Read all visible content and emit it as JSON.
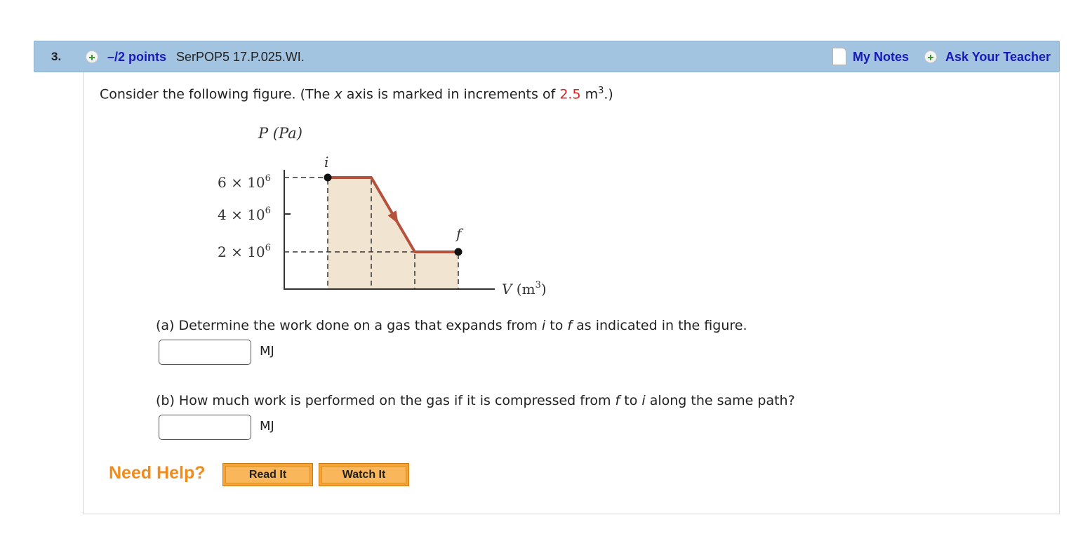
{
  "header": {
    "question_number": "3.",
    "points": "–/2 points",
    "source": "SerPOP5 17.P.025.WI.",
    "my_notes": "My Notes",
    "ask_teacher": "Ask Your Teacher",
    "icons": [
      "plus-circle-icon",
      "notes-icon",
      "plus-circle-icon"
    ]
  },
  "prompt": {
    "pre": "Consider the following figure. (The ",
    "var": "x",
    "mid": " axis is marked in increments of ",
    "value": "2.5",
    "unit": " m",
    "sup": "3",
    "post": ".)"
  },
  "figure": {
    "y_title": "P (Pa)",
    "x_title": "V (m",
    "x_title_sup": "3",
    "x_title_end": ")",
    "y_ticks": [
      {
        "base": "6 × 10",
        "exp": "6"
      },
      {
        "base": "4 × 10",
        "exp": "6"
      },
      {
        "base": "2 × 10",
        "exp": "6"
      }
    ],
    "point_i": "i",
    "point_f": "f",
    "colors": {
      "path": "#b5523b",
      "fill": "#f1e4d0",
      "point": "#111111"
    }
  },
  "chart_data": {
    "type": "line",
    "title": "",
    "xlabel": "V (m³)",
    "ylabel": "P (Pa)",
    "x_tick_increment": 2.5,
    "x": [
      2.5,
      5.0,
      7.5,
      10.0
    ],
    "series": [
      {
        "values": [
          6000000,
          6000000,
          2000000,
          2000000
        ]
      }
    ],
    "y_tick_labels": [
      "6 × 10⁶",
      "4 × 10⁶",
      "2 × 10⁶"
    ],
    "xlim": [
      0,
      12.5
    ],
    "ylim": [
      0,
      7000000
    ],
    "points": [
      {
        "label": "i",
        "x": 2.5,
        "y": 6000000
      },
      {
        "label": "f",
        "x": 10.0,
        "y": 2000000
      }
    ],
    "shaded_area_under_path": true,
    "grid": false
  },
  "part_a": {
    "pre": "(a) Determine the work done on a gas that expands from ",
    "var1": "i",
    "mid": " to ",
    "var2": "f",
    "post": " as indicated in the figure.",
    "answer_value": "",
    "unit": "MJ"
  },
  "part_b": {
    "pre": "(b) How much work is performed on the gas if it is compressed from ",
    "var1": "f",
    "mid": " to ",
    "var2": "i",
    "post": " along the same path?",
    "answer_value": "",
    "unit": "MJ"
  },
  "help": {
    "label": "Need Help?",
    "read_it": "Read It",
    "watch_it": "Watch It"
  }
}
